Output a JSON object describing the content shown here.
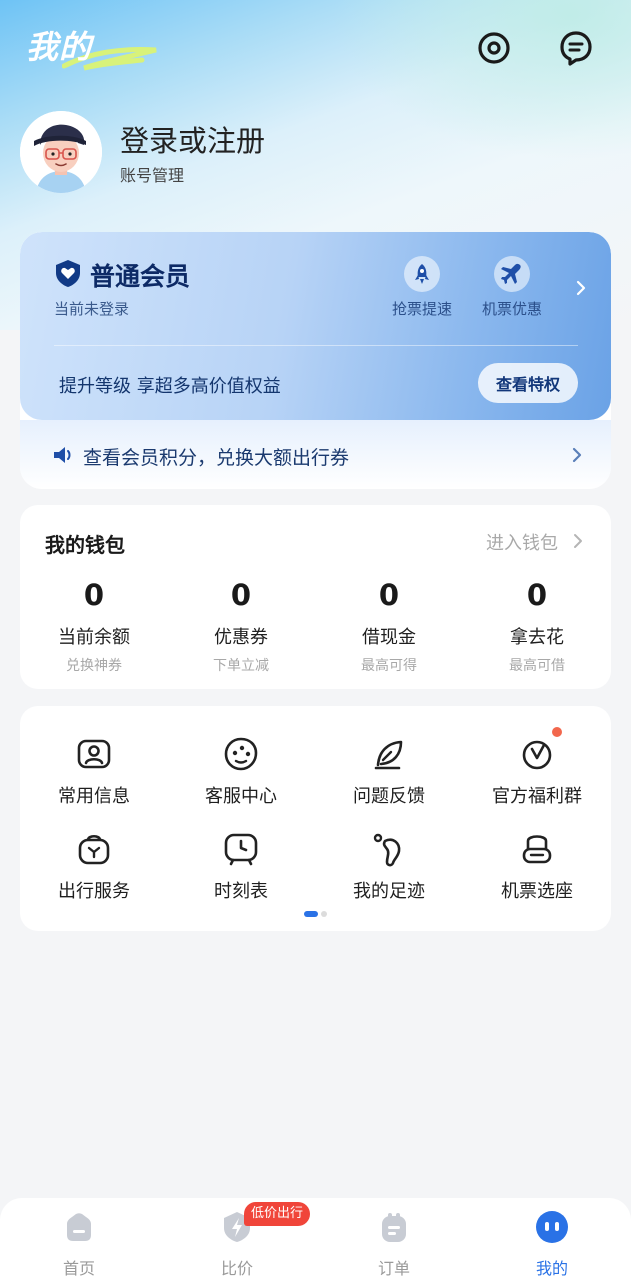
{
  "header": {
    "title": "我的",
    "settings_icon": "settings-icon",
    "message_icon": "message-icon"
  },
  "profile": {
    "login_text": "登录或注册",
    "account_manage": "账号管理"
  },
  "member": {
    "level": "普通会员",
    "status": "当前未登录",
    "perks": [
      {
        "label": "抢票提速",
        "icon": "rocket-icon"
      },
      {
        "label": "机票优惠",
        "icon": "airplane-icon"
      }
    ],
    "upgrade_text": "提升等级 享超多高价值权益",
    "privilege_button": "查看特权",
    "points_text": "查看会员积分，兑换大额出行券"
  },
  "wallet": {
    "title": "我的钱包",
    "enter_label": "进入钱包",
    "items": [
      {
        "value": "0",
        "label": "当前余额",
        "sub": "兑换神券"
      },
      {
        "value": "0",
        "label": "优惠券",
        "sub": "下单立减"
      },
      {
        "value": "0",
        "label": "借现金",
        "sub": "最高可得"
      },
      {
        "value": "0",
        "label": "拿去花",
        "sub": "最高可借"
      }
    ]
  },
  "services": {
    "items": [
      {
        "label": "常用信息",
        "icon": "id-card-icon"
      },
      {
        "label": "客服中心",
        "icon": "customer-service-icon"
      },
      {
        "label": "问题反馈",
        "icon": "feedback-icon"
      },
      {
        "label": "官方福利群",
        "icon": "welfare-group-icon"
      },
      {
        "label": "出行服务",
        "icon": "travel-bag-icon"
      },
      {
        "label": "时刻表",
        "icon": "schedule-icon"
      },
      {
        "label": "我的足迹",
        "icon": "footprint-icon"
      },
      {
        "label": "机票选座",
        "icon": "seat-icon"
      }
    ]
  },
  "tabbar": {
    "tabs": [
      {
        "label": "首页",
        "icon": "home-icon"
      },
      {
        "label": "比价",
        "icon": "compare-price-icon"
      },
      {
        "label": "订单",
        "icon": "order-icon"
      },
      {
        "label": "我的",
        "icon": "profile-icon"
      }
    ],
    "badge": "低价出行"
  },
  "colors": {
    "accent": "#2a72e6",
    "member_text": "#0d2a66",
    "badge": "#f0453a",
    "notify_dot": "#f2674d"
  }
}
